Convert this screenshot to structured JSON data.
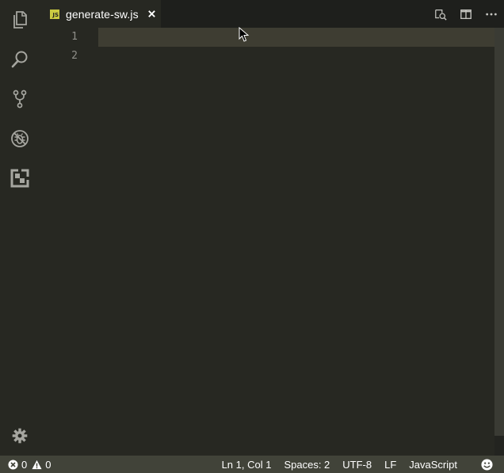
{
  "activity_bar": {
    "items": [
      {
        "name": "explorer",
        "icon": "files-icon"
      },
      {
        "name": "search",
        "icon": "search-icon"
      },
      {
        "name": "source-control",
        "icon": "source-control-icon"
      },
      {
        "name": "debug",
        "icon": "debug-icon"
      },
      {
        "name": "extensions",
        "icon": "extensions-icon"
      }
    ],
    "settings_icon": "gear-icon"
  },
  "tabs": [
    {
      "label": "generate-sw.js",
      "badge": "JS",
      "badge_color": "#cbcb41",
      "active": true
    }
  ],
  "editor_actions": [
    "open-preview-icon",
    "split-editor-icon",
    "more-actions-icon"
  ],
  "editor": {
    "line_numbers": [
      "1",
      "2"
    ],
    "current_line": 1
  },
  "status_bar": {
    "errors": "0",
    "warnings": "0",
    "position": "Ln 1, Col 1",
    "indentation": "Spaces: 2",
    "encoding": "UTF-8",
    "eol": "LF",
    "language": "JavaScript",
    "feedback_icon": "smiley-icon"
  },
  "colors": {
    "background": "#272822",
    "tab_bar": "#1e1f1c",
    "status_bar": "#414339",
    "current_line": "#3e3d32"
  }
}
